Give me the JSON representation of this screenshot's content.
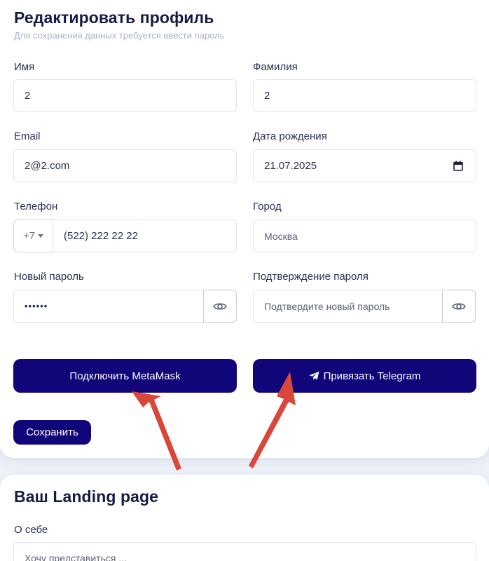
{
  "profile": {
    "title": "Редактировать профиль",
    "subtitle": "Для сохранения данных требуется ввести пароль",
    "first_name": {
      "label": "Имя",
      "value": "2"
    },
    "last_name": {
      "label": "Фамилия",
      "value": "2"
    },
    "email": {
      "label": "Email",
      "value": "2@2.com"
    },
    "birth_date": {
      "label": "Дата рождения",
      "value": "21.07.2025",
      "icon": "calendar-icon"
    },
    "phone": {
      "label": "Телефон",
      "country_code": "+7",
      "value": "(522) 222 22 22"
    },
    "city": {
      "label": "Город",
      "placeholder": "Москва"
    },
    "new_password": {
      "label": "Новый пароль",
      "value": "••••••",
      "icon": "eye-icon"
    },
    "confirm_password": {
      "label": "Подтверждение пароля",
      "placeholder": "Подтвердите новый пароль",
      "icon": "eye-icon"
    },
    "metamask_button": "Подключить MetaMask",
    "telegram_button": "Привязать Telegram",
    "telegram_icon": "telegram-plane-icon",
    "save_button": "Сохранить"
  },
  "landing": {
    "title": "Ваш Landing page",
    "about_label": "О себе",
    "about_placeholder": "Хочу представиться ..."
  },
  "colors": {
    "primary": "#10067a",
    "title": "#161b45",
    "subtitle": "#a9b2c6",
    "arrow": "#d9473a"
  }
}
